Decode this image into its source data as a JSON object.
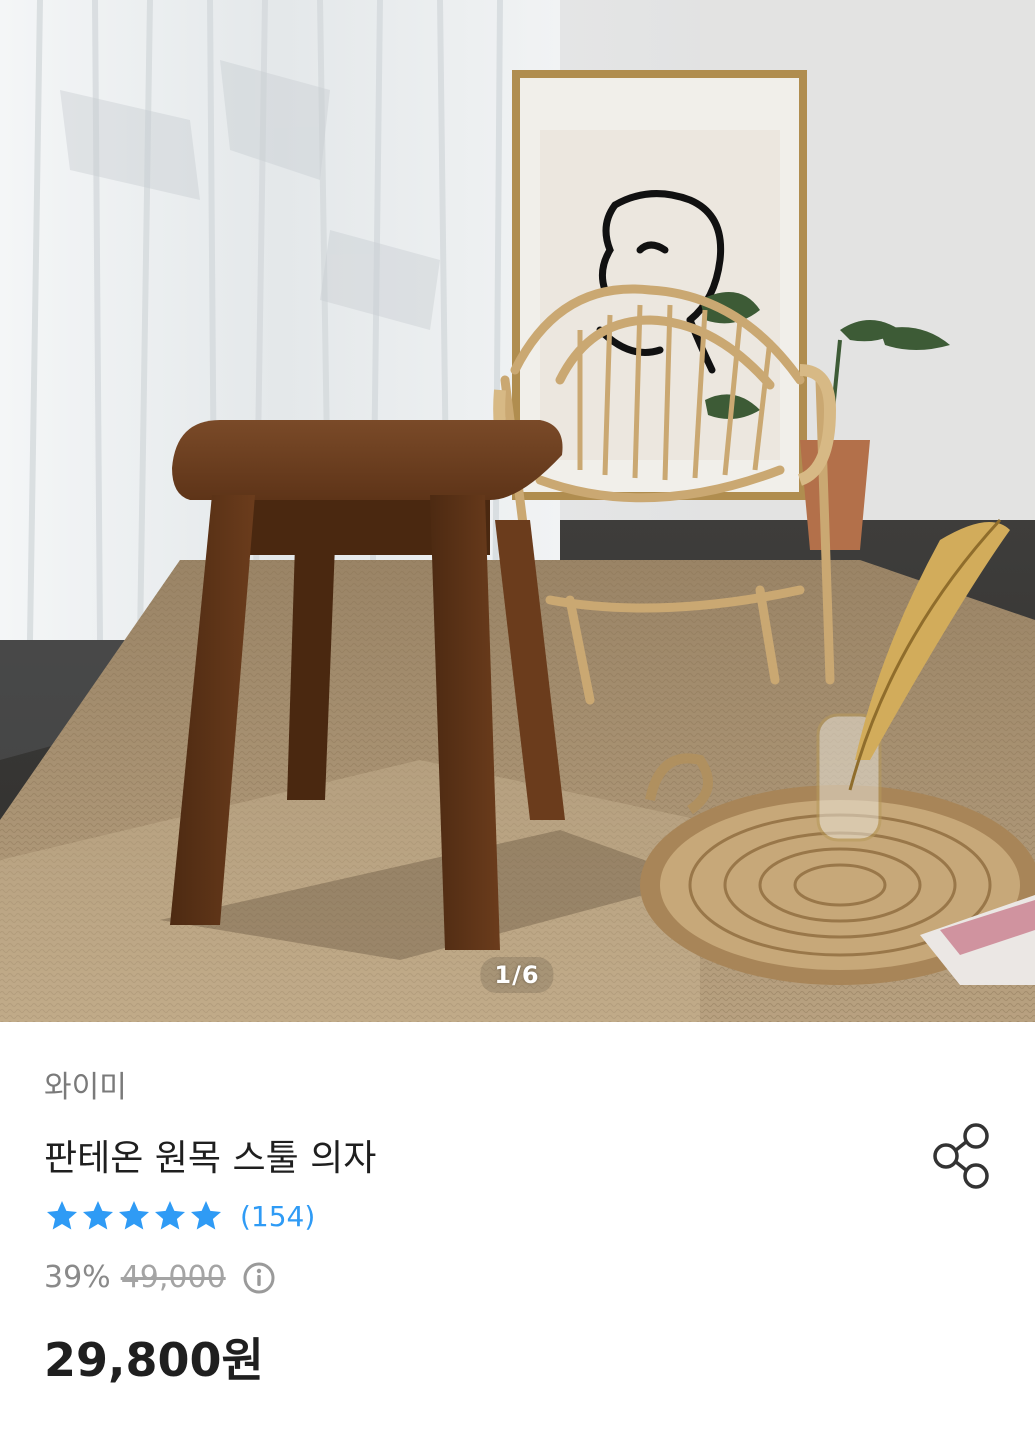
{
  "gallery": {
    "counter": "1/6"
  },
  "product": {
    "brand": "와이미",
    "title": "판테온 원목 스툴 의자",
    "rating": {
      "stars": 5,
      "review_count": "(154)"
    },
    "price": {
      "discount": "39%",
      "original": "49,000",
      "sale": "29,800원"
    }
  },
  "icons": {
    "share": "share-icon",
    "info": "info-circle-icon",
    "star": "star-icon"
  },
  "colors": {
    "accent_blue": "#2f9bf5",
    "text_dark": "#1f1f1f",
    "text_gray": "#7a7a7a"
  }
}
